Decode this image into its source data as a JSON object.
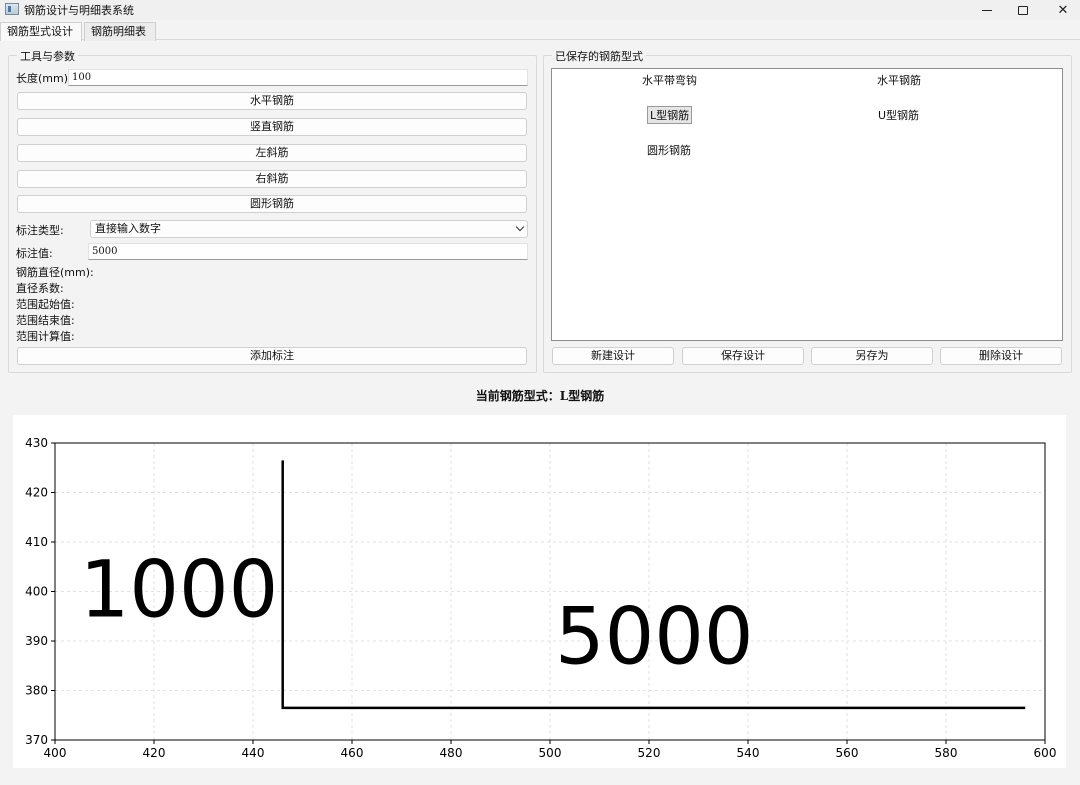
{
  "window": {
    "title": "钢筋设计与明细表系统"
  },
  "tabs": [
    {
      "label": "钢筋型式设计"
    },
    {
      "label": "钢筋明细表"
    }
  ],
  "tools": {
    "group_title": "工具与参数",
    "length_label": "长度(mm):",
    "length_value": "100",
    "buttons": {
      "horizontal": "水平钢筋",
      "vertical": "竖直钢筋",
      "left_diag": "左斜筋",
      "right_diag": "右斜筋",
      "circular": "圆形钢筋"
    },
    "annotation_type_label": "标注类型:",
    "annotation_type_value": "直接输入数字",
    "annotation_value_label": "标注值:",
    "annotation_value": "5000",
    "diameter_label": "钢筋直径(mm):",
    "coef_label": "直径系数:",
    "range_start_label": "范围起始值:",
    "range_end_label": "范围结束值:",
    "range_calc_label": "范围计算值:",
    "add_annotation": "添加标注"
  },
  "saved": {
    "group_title": "已保存的钢筋型式",
    "items": [
      {
        "label": "水平带弯钩"
      },
      {
        "label": "水平钢筋"
      },
      {
        "label": "L型钢筋"
      },
      {
        "label": "U型钢筋"
      },
      {
        "label": "圆形钢筋"
      }
    ],
    "selected_index": 2,
    "buttons": {
      "new": "新建设计",
      "save": "保存设计",
      "save_as": "另存为",
      "delete": "删除设计"
    }
  },
  "current_design": {
    "title": "当前钢筋型式：L型钢筋"
  },
  "chart_data": {
    "type": "line",
    "xlim": [
      400,
      600
    ],
    "ylim": [
      370,
      430
    ],
    "xticks": [
      400,
      420,
      440,
      460,
      480,
      500,
      520,
      540,
      560,
      580,
      600
    ],
    "yticks": [
      370,
      380,
      390,
      400,
      410,
      420,
      430
    ],
    "grid": true,
    "series": [
      {
        "x": [
          446,
          446,
          596
        ],
        "y": [
          426.5,
          376.5,
          376.5
        ],
        "color": "#000000"
      }
    ],
    "annotations": [
      {
        "text": "1000",
        "x": 405,
        "y": 395
      },
      {
        "text": "5000",
        "x": 501,
        "y": 385.5
      }
    ]
  }
}
